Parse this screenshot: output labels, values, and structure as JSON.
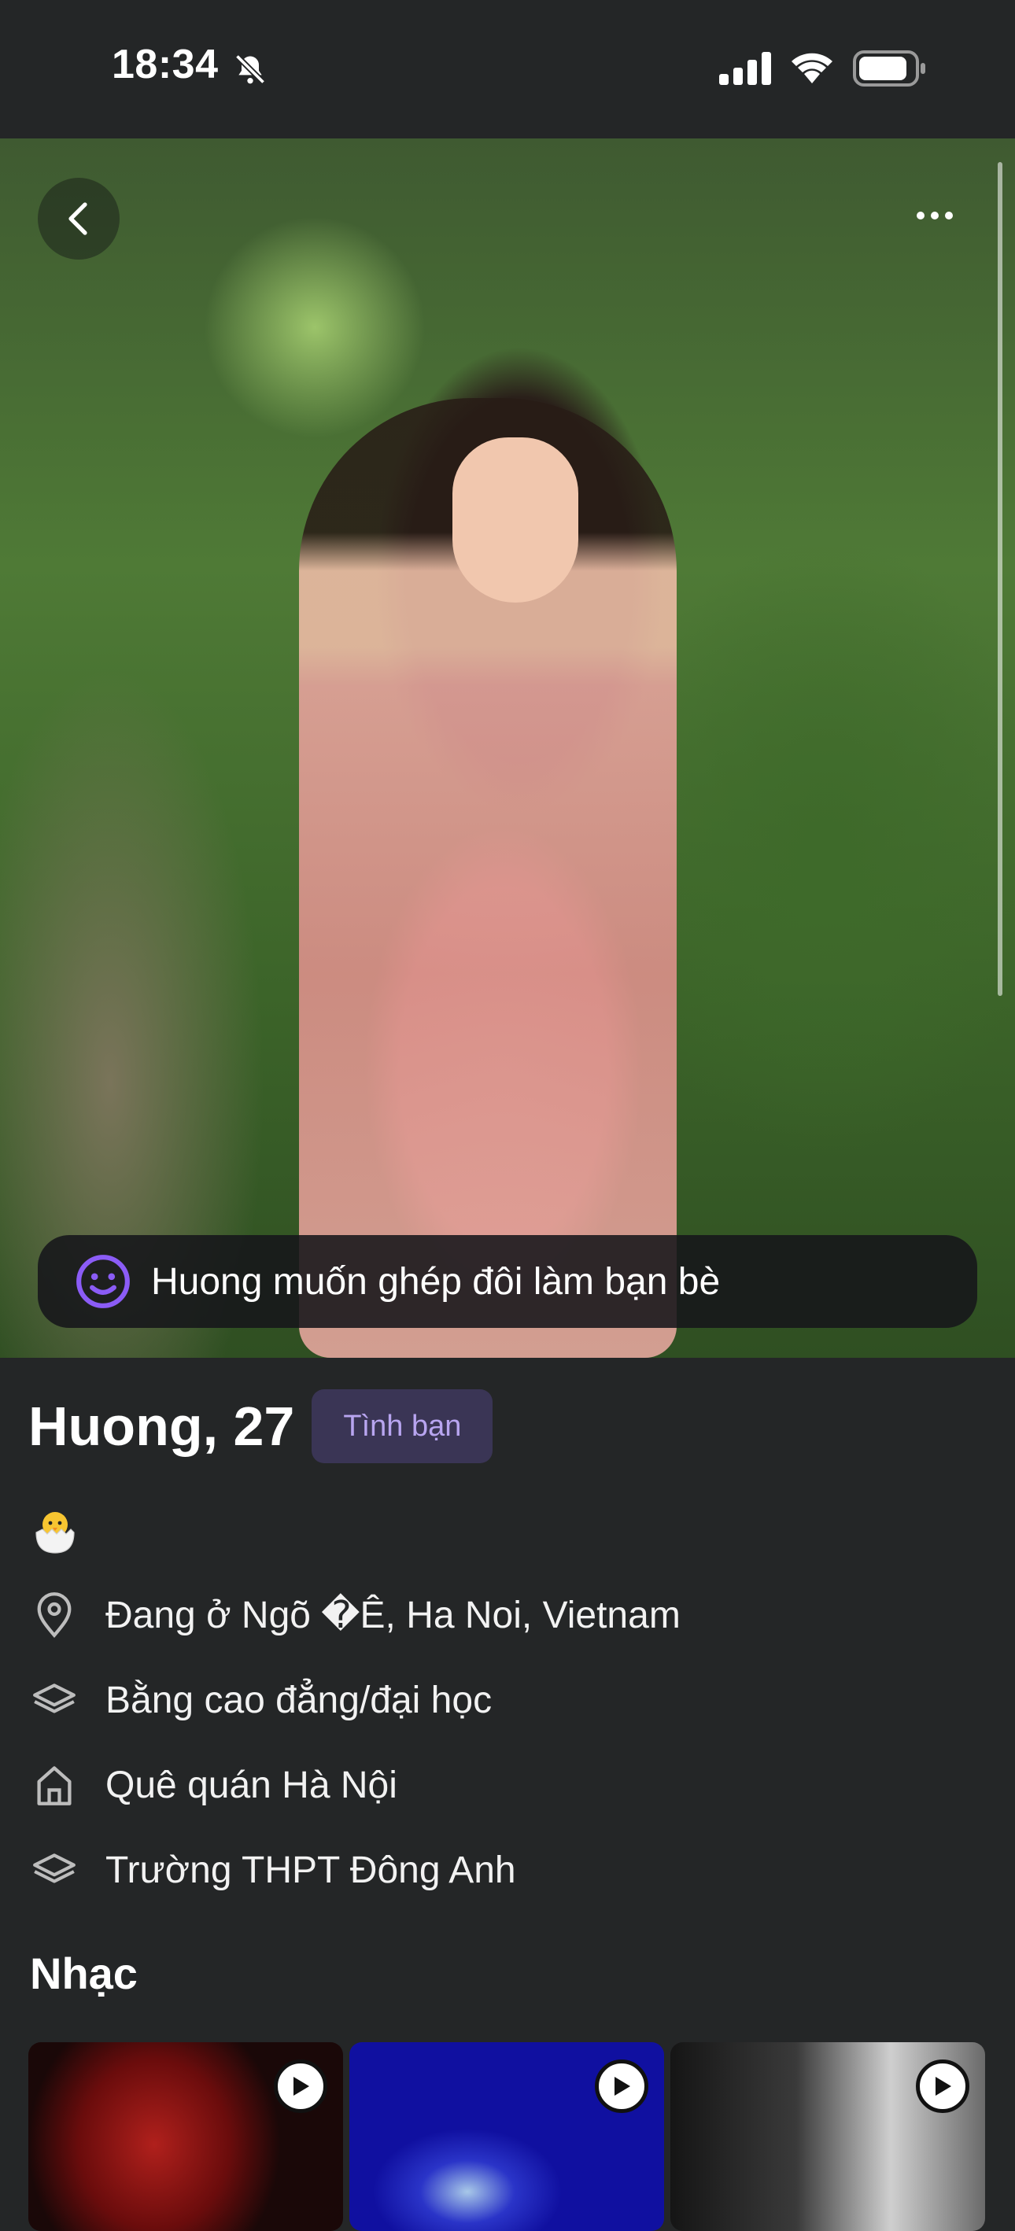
{
  "status_bar": {
    "time": "18:34"
  },
  "photo": {
    "banner_text": "Huong muốn ghép đôi làm bạn bè"
  },
  "profile": {
    "name_age": "Huong, 27",
    "tag": "Tình bạn",
    "emoji": "hatching-chick",
    "details": [
      {
        "icon": "location-pin-icon",
        "label": "Đang ở Ngõ �Ê, Ha Noi, Vietnam"
      },
      {
        "icon": "graduation-cap-icon",
        "label": "Bằng cao đẳng/đại học"
      },
      {
        "icon": "home-icon",
        "label": "Quê quán Hà Nội"
      },
      {
        "icon": "graduation-cap-icon",
        "label": "Trường THPT Đông Anh"
      }
    ]
  },
  "music": {
    "title": "Nhạc",
    "tracks": [
      {
        "artwork": "red-hooded-figure"
      },
      {
        "artwork": "blue-night-scene"
      },
      {
        "artwork": "black-white-portrait"
      }
    ]
  },
  "colors": {
    "background": "#242627",
    "tag_bg": "#3a3555",
    "tag_text": "#b8a5f0",
    "accent_purple": "#8b5cf6"
  }
}
